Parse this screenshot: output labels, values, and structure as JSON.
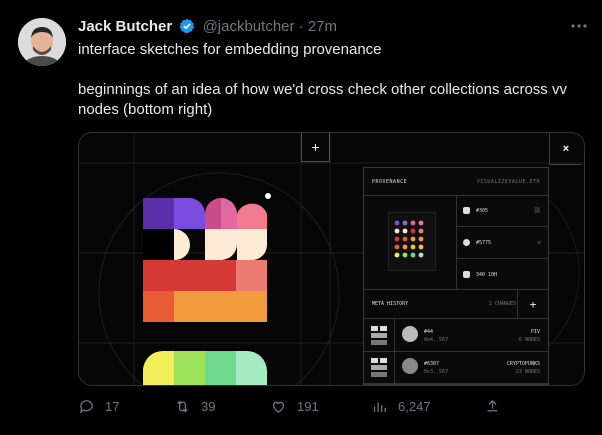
{
  "author": {
    "name": "Jack Butcher",
    "handle": "@jackbutcher",
    "separator": "·",
    "time": "27m"
  },
  "tweet": {
    "line1": "interface sketches for embedding provenance",
    "line2": "beginnings of an idea of how we'd cross check other collections across vv nodes (bottom right)"
  },
  "media": {
    "plus_label": "+",
    "close_label": "×",
    "panel": {
      "title": "PROVENANCE",
      "domain": "VISUALIZEVALUE.ETH",
      "items": [
        {
          "label": "#305"
        },
        {
          "label": "#5775"
        },
        {
          "label": "340 10H"
        }
      ],
      "meta_title": "META HISTORY",
      "meta_changes": "2 CHANGES",
      "meta_plus": "+",
      "rows": [
        {
          "id": "#44",
          "addr": "0x4..567",
          "collection": "PIV",
          "nodes": "6 NODES"
        },
        {
          "id": "#6307",
          "addr": "0x3..567",
          "collection": "CRYPTOPUNKS",
          "nodes": "23 NODES"
        }
      ]
    }
  },
  "actions": {
    "replies": "17",
    "retweets": "39",
    "likes": "191",
    "views": "6,247"
  },
  "colors": {
    "accent_blue": "#1d9bf0",
    "muted": "#71767b"
  }
}
